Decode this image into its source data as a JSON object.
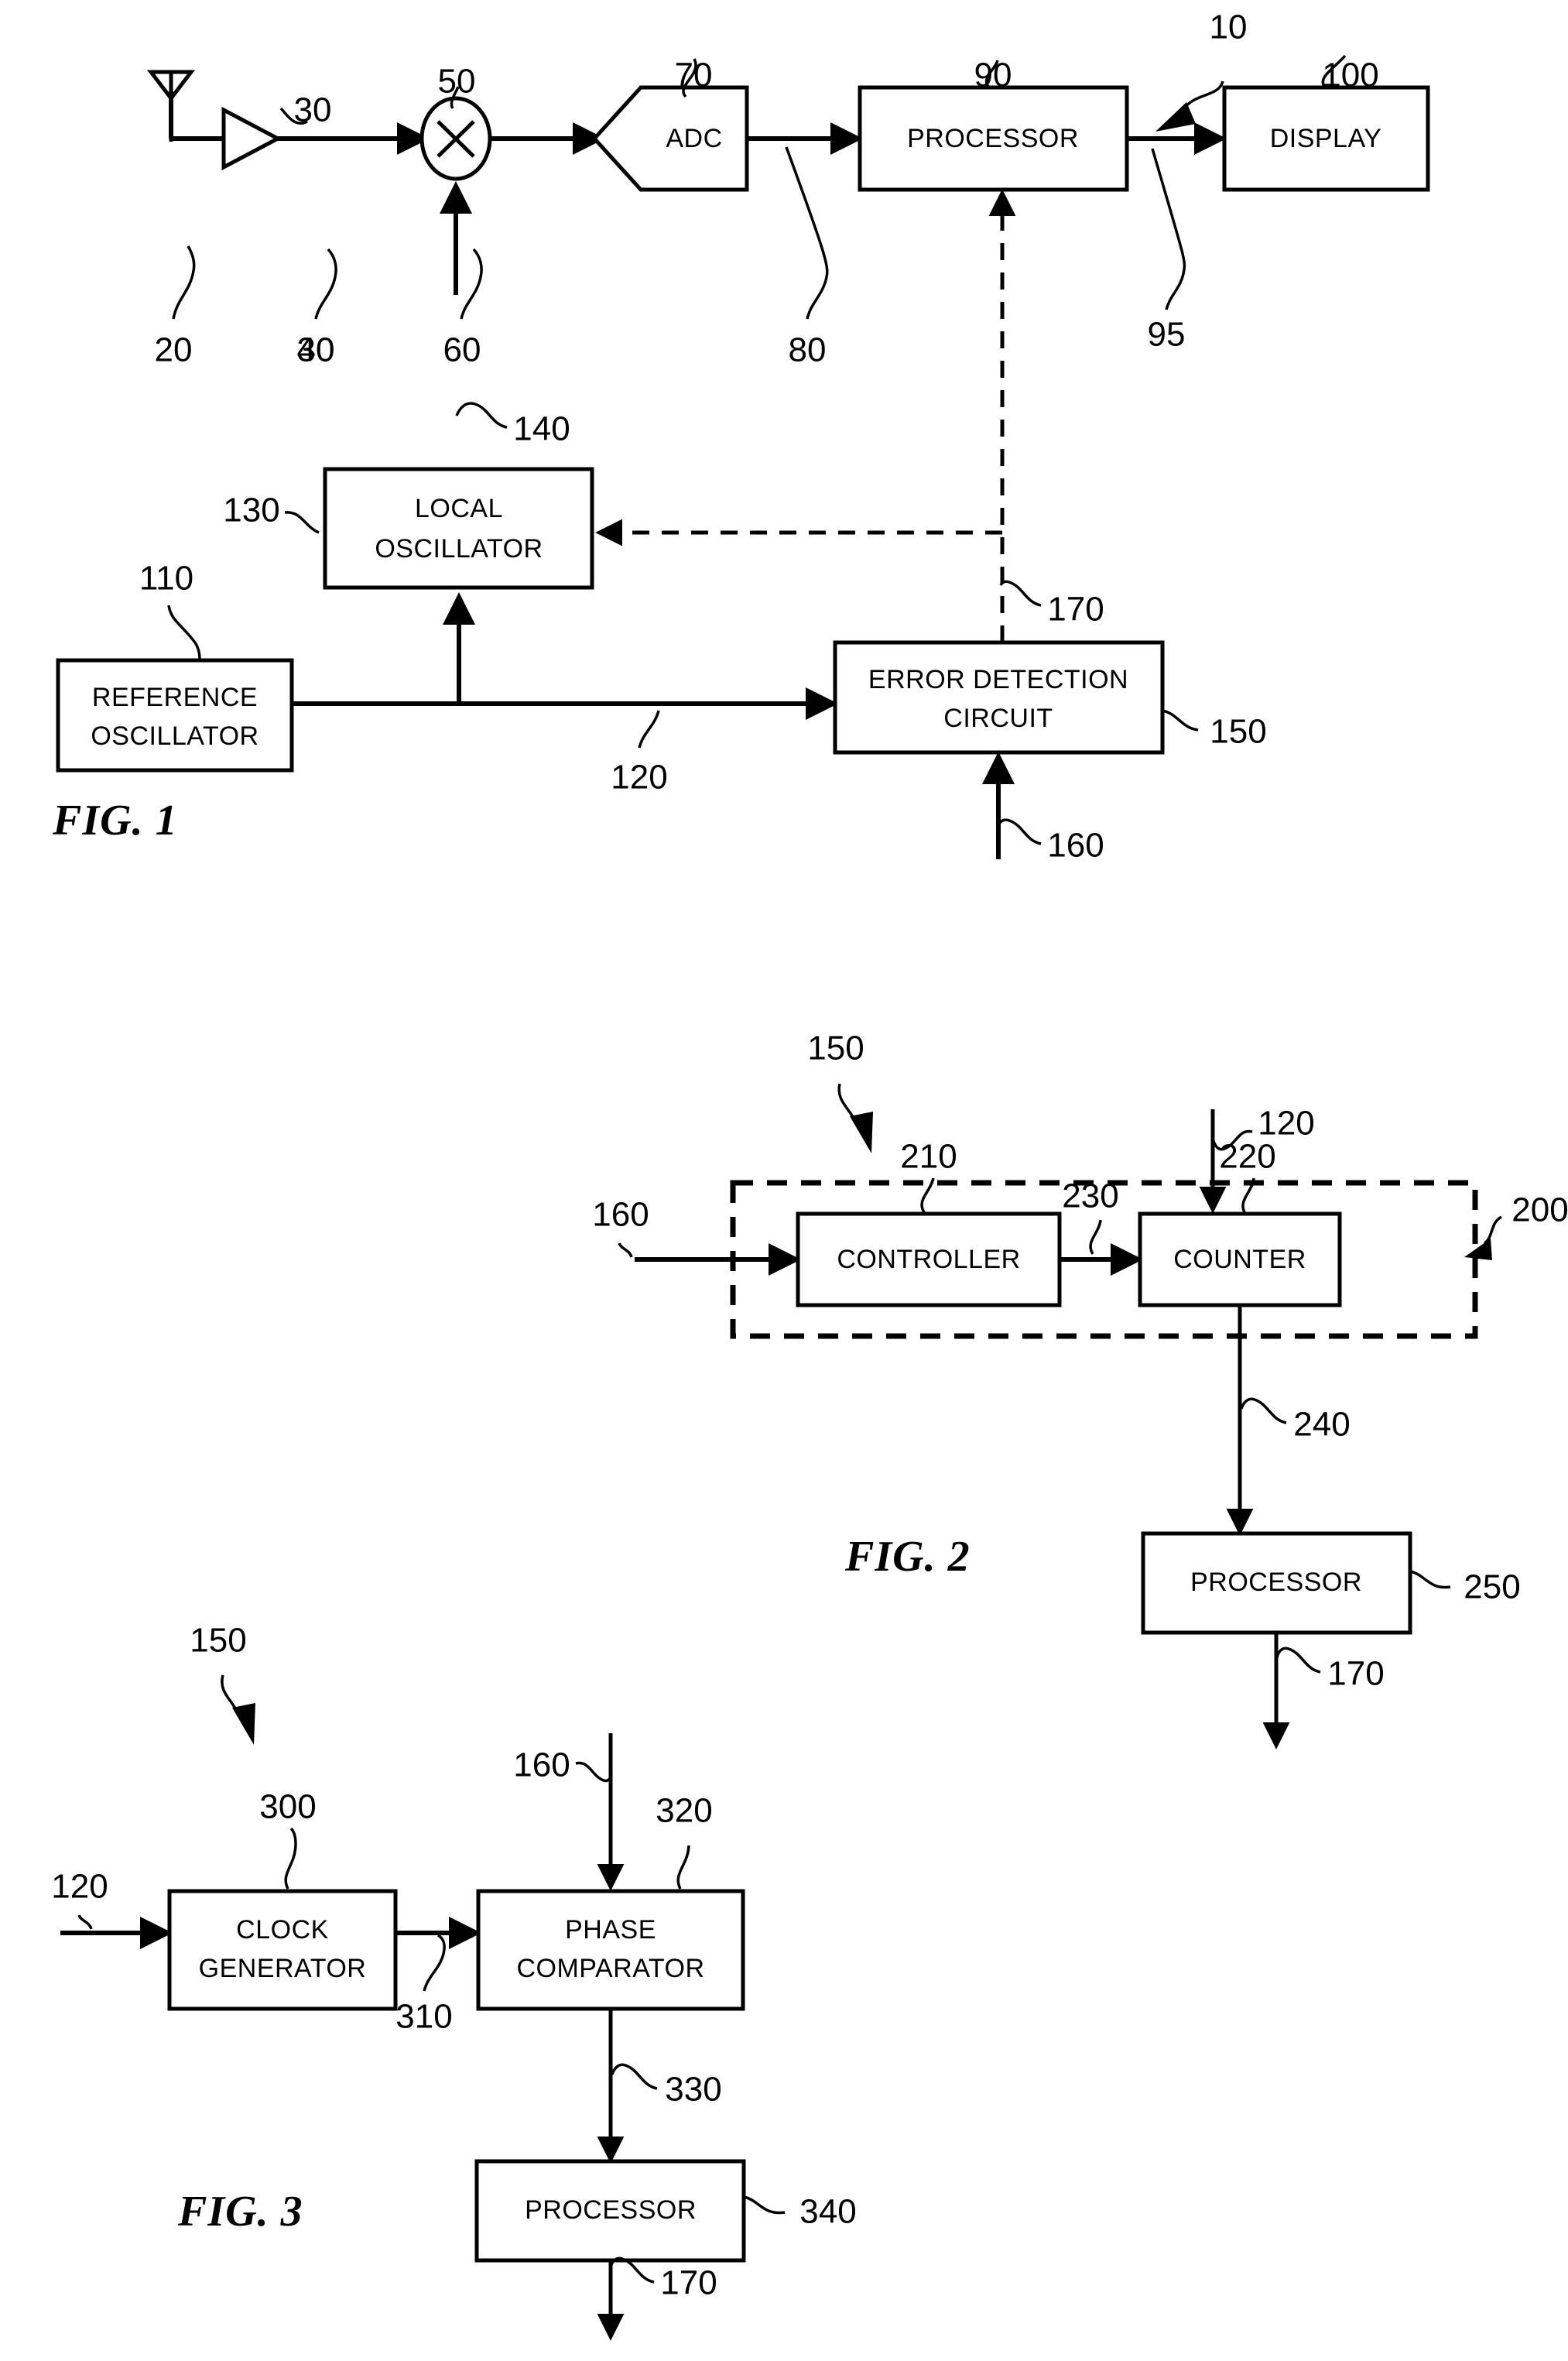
{
  "figures": [
    {
      "caption": "FIG. 1",
      "assembly_ref": "10",
      "blocks": [
        {
          "id": "adc",
          "label": "ADC",
          "ref": "70"
        },
        {
          "id": "processor",
          "label": "PROCESSOR",
          "ref": "90"
        },
        {
          "id": "display",
          "label": "DISPLAY",
          "ref": "100"
        },
        {
          "id": "local_oscillator",
          "label_line1": "LOCAL",
          "label_line2": "OSCILLATOR",
          "ref": "130"
        },
        {
          "id": "reference_oscillator",
          "label_line1": "REFERENCE",
          "label_line2": "OSCILLATOR",
          "ref": "110"
        },
        {
          "id": "error_detection_circuit",
          "label_line1": "ERROR DETECTION",
          "label_line2": "CIRCUIT",
          "ref": "150"
        }
      ],
      "symbols": [
        {
          "id": "antenna",
          "ref": "20"
        },
        {
          "id": "amplifier",
          "ref": "30"
        },
        {
          "id": "mixer",
          "label": "×",
          "ref": "50"
        }
      ],
      "signal_refs": [
        "20",
        "40",
        "60",
        "80",
        "95",
        "120",
        "140",
        "160",
        "170"
      ]
    },
    {
      "caption": "FIG. 2",
      "assembly_ref": "150",
      "dashed_group_ref": "200",
      "blocks": [
        {
          "id": "controller",
          "label": "CONTROLLER",
          "ref": "210"
        },
        {
          "id": "counter",
          "label": "COUNTER",
          "ref": "220"
        },
        {
          "id": "processor",
          "label": "PROCESSOR",
          "ref": "250"
        }
      ],
      "signal_refs": [
        "120",
        "160",
        "230",
        "240",
        "170"
      ]
    },
    {
      "caption": "FIG. 3",
      "assembly_ref": "150",
      "blocks": [
        {
          "id": "clock_generator",
          "label_line1": "CLOCK",
          "label_line2": "GENERATOR",
          "ref": "300"
        },
        {
          "id": "phase_comparator",
          "label_line1": "PHASE",
          "label_line2": "COMPARATOR",
          "ref": "320"
        },
        {
          "id": "processor",
          "label": "PROCESSOR",
          "ref": "340"
        }
      ],
      "signal_refs": [
        "120",
        "160",
        "310",
        "330",
        "170"
      ]
    }
  ],
  "fig1": {
    "caption": "FIG. 1",
    "ref_10": "10",
    "ref_20": "20",
    "ref_30": "30",
    "ref_40": "40",
    "ref_50": "50",
    "ref_60": "60",
    "ref_70": "70",
    "ref_80": "80",
    "ref_90": "90",
    "ref_95": "95",
    "ref_100": "100",
    "ref_110": "110",
    "ref_120": "120",
    "ref_130": "130",
    "ref_140": "140",
    "ref_150": "150",
    "ref_160": "160",
    "ref_170": "170",
    "mixer_glyph": "×",
    "adc_label": "ADC",
    "processor_label": "PROCESSOR",
    "display_label": "DISPLAY",
    "local_osc_line1": "LOCAL",
    "local_osc_line2": "OSCILLATOR",
    "ref_osc_line1": "REFERENCE",
    "ref_osc_line2": "OSCILLATOR",
    "error_line1": "ERROR DETECTION",
    "error_line2": "CIRCUIT"
  },
  "fig2": {
    "caption": "FIG. 2",
    "ref_150": "150",
    "ref_120": "120",
    "ref_160": "160",
    "ref_200": "200",
    "ref_210": "210",
    "ref_220": "220",
    "ref_230": "230",
    "ref_240": "240",
    "ref_250": "250",
    "ref_170": "170",
    "controller_label": "CONTROLLER",
    "counter_label": "COUNTER",
    "processor_label": "PROCESSOR"
  },
  "fig3": {
    "caption": "FIG. 3",
    "ref_150": "150",
    "ref_120": "120",
    "ref_160": "160",
    "ref_300": "300",
    "ref_310": "310",
    "ref_320": "320",
    "ref_330": "330",
    "ref_340": "340",
    "ref_170": "170",
    "clock_line1": "CLOCK",
    "clock_line2": "GENERATOR",
    "phase_line1": "PHASE",
    "phase_line2": "COMPARATOR",
    "processor_label": "PROCESSOR"
  }
}
